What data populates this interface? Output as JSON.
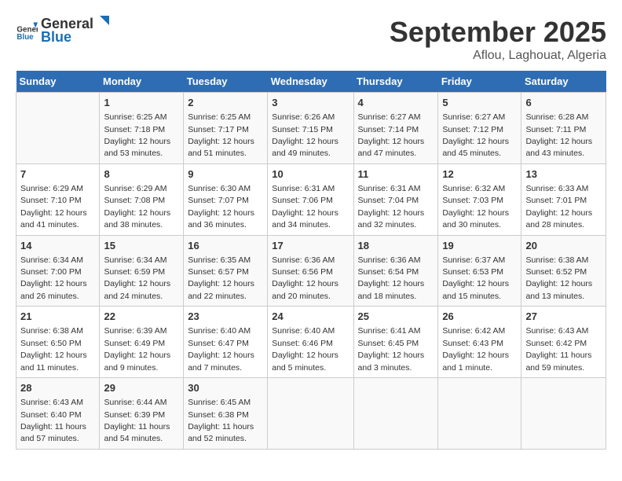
{
  "logo": {
    "general": "General",
    "blue": "Blue"
  },
  "title": "September 2025",
  "subtitle": "Aflou, Laghouat, Algeria",
  "weekdays": [
    "Sunday",
    "Monday",
    "Tuesday",
    "Wednesday",
    "Thursday",
    "Friday",
    "Saturday"
  ],
  "weeks": [
    [
      {
        "day": "",
        "info": ""
      },
      {
        "day": "1",
        "info": "Sunrise: 6:25 AM\nSunset: 7:18 PM\nDaylight: 12 hours\nand 53 minutes."
      },
      {
        "day": "2",
        "info": "Sunrise: 6:25 AM\nSunset: 7:17 PM\nDaylight: 12 hours\nand 51 minutes."
      },
      {
        "day": "3",
        "info": "Sunrise: 6:26 AM\nSunset: 7:15 PM\nDaylight: 12 hours\nand 49 minutes."
      },
      {
        "day": "4",
        "info": "Sunrise: 6:27 AM\nSunset: 7:14 PM\nDaylight: 12 hours\nand 47 minutes."
      },
      {
        "day": "5",
        "info": "Sunrise: 6:27 AM\nSunset: 7:12 PM\nDaylight: 12 hours\nand 45 minutes."
      },
      {
        "day": "6",
        "info": "Sunrise: 6:28 AM\nSunset: 7:11 PM\nDaylight: 12 hours\nand 43 minutes."
      }
    ],
    [
      {
        "day": "7",
        "info": "Sunrise: 6:29 AM\nSunset: 7:10 PM\nDaylight: 12 hours\nand 41 minutes."
      },
      {
        "day": "8",
        "info": "Sunrise: 6:29 AM\nSunset: 7:08 PM\nDaylight: 12 hours\nand 38 minutes."
      },
      {
        "day": "9",
        "info": "Sunrise: 6:30 AM\nSunset: 7:07 PM\nDaylight: 12 hours\nand 36 minutes."
      },
      {
        "day": "10",
        "info": "Sunrise: 6:31 AM\nSunset: 7:06 PM\nDaylight: 12 hours\nand 34 minutes."
      },
      {
        "day": "11",
        "info": "Sunrise: 6:31 AM\nSunset: 7:04 PM\nDaylight: 12 hours\nand 32 minutes."
      },
      {
        "day": "12",
        "info": "Sunrise: 6:32 AM\nSunset: 7:03 PM\nDaylight: 12 hours\nand 30 minutes."
      },
      {
        "day": "13",
        "info": "Sunrise: 6:33 AM\nSunset: 7:01 PM\nDaylight: 12 hours\nand 28 minutes."
      }
    ],
    [
      {
        "day": "14",
        "info": "Sunrise: 6:34 AM\nSunset: 7:00 PM\nDaylight: 12 hours\nand 26 minutes."
      },
      {
        "day": "15",
        "info": "Sunrise: 6:34 AM\nSunset: 6:59 PM\nDaylight: 12 hours\nand 24 minutes."
      },
      {
        "day": "16",
        "info": "Sunrise: 6:35 AM\nSunset: 6:57 PM\nDaylight: 12 hours\nand 22 minutes."
      },
      {
        "day": "17",
        "info": "Sunrise: 6:36 AM\nSunset: 6:56 PM\nDaylight: 12 hours\nand 20 minutes."
      },
      {
        "day": "18",
        "info": "Sunrise: 6:36 AM\nSunset: 6:54 PM\nDaylight: 12 hours\nand 18 minutes."
      },
      {
        "day": "19",
        "info": "Sunrise: 6:37 AM\nSunset: 6:53 PM\nDaylight: 12 hours\nand 15 minutes."
      },
      {
        "day": "20",
        "info": "Sunrise: 6:38 AM\nSunset: 6:52 PM\nDaylight: 12 hours\nand 13 minutes."
      }
    ],
    [
      {
        "day": "21",
        "info": "Sunrise: 6:38 AM\nSunset: 6:50 PM\nDaylight: 12 hours\nand 11 minutes."
      },
      {
        "day": "22",
        "info": "Sunrise: 6:39 AM\nSunset: 6:49 PM\nDaylight: 12 hours\nand 9 minutes."
      },
      {
        "day": "23",
        "info": "Sunrise: 6:40 AM\nSunset: 6:47 PM\nDaylight: 12 hours\nand 7 minutes."
      },
      {
        "day": "24",
        "info": "Sunrise: 6:40 AM\nSunset: 6:46 PM\nDaylight: 12 hours\nand 5 minutes."
      },
      {
        "day": "25",
        "info": "Sunrise: 6:41 AM\nSunset: 6:45 PM\nDaylight: 12 hours\nand 3 minutes."
      },
      {
        "day": "26",
        "info": "Sunrise: 6:42 AM\nSunset: 6:43 PM\nDaylight: 12 hours\nand 1 minute."
      },
      {
        "day": "27",
        "info": "Sunrise: 6:43 AM\nSunset: 6:42 PM\nDaylight: 11 hours\nand 59 minutes."
      }
    ],
    [
      {
        "day": "28",
        "info": "Sunrise: 6:43 AM\nSunset: 6:40 PM\nDaylight: 11 hours\nand 57 minutes."
      },
      {
        "day": "29",
        "info": "Sunrise: 6:44 AM\nSunset: 6:39 PM\nDaylight: 11 hours\nand 54 minutes."
      },
      {
        "day": "30",
        "info": "Sunrise: 6:45 AM\nSunset: 6:38 PM\nDaylight: 11 hours\nand 52 minutes."
      },
      {
        "day": "",
        "info": ""
      },
      {
        "day": "",
        "info": ""
      },
      {
        "day": "",
        "info": ""
      },
      {
        "day": "",
        "info": ""
      }
    ]
  ]
}
